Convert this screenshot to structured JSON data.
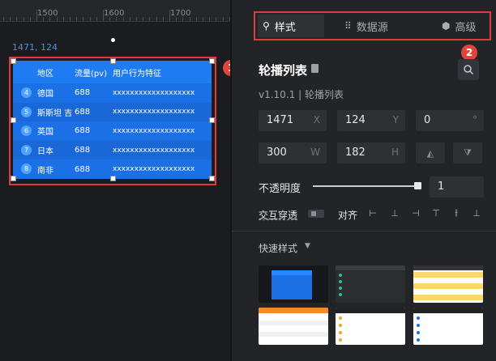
{
  "canvas": {
    "ruler_labels": [
      "1500",
      "1600",
      "1700"
    ],
    "coords": "1471, 124",
    "table": {
      "headers": [
        "地区",
        "流量(pv)",
        "用户行为特征"
      ],
      "rows": [
        {
          "idx": "4",
          "region": "德国",
          "pv": "688",
          "feature": "xxxxxxxxxxxxxxxxxxx"
        },
        {
          "idx": "5",
          "region": "斯斯坦 吉",
          "pv": "688",
          "feature": "xxxxxxxxxxxxxxxxxxx"
        },
        {
          "idx": "6",
          "region": "英国",
          "pv": "688",
          "feature": "xxxxxxxxxxxxxxxxxxx"
        },
        {
          "idx": "7",
          "region": "日本",
          "pv": "688",
          "feature": "xxxxxxxxxxxxxxxxxxx"
        },
        {
          "idx": "8",
          "region": "南非",
          "pv": "688",
          "feature": "xxxxxxxxxxxxxxxxxxx"
        }
      ]
    },
    "badge1": "1"
  },
  "panel": {
    "tabs": [
      {
        "label": "样式",
        "icon": "style-icon"
      },
      {
        "label": "数据源",
        "icon": "datasource-icon"
      },
      {
        "label": "高级",
        "icon": "advanced-icon"
      }
    ],
    "badge2": "2",
    "title": "轮播列表",
    "version": "v1.10.1 | 轮播列表",
    "x": "1471",
    "x_unit": "X",
    "y": "124",
    "y_unit": "Y",
    "rotate": "0",
    "rotate_unit": "°",
    "w": "300",
    "w_unit": "W",
    "h": "182",
    "h_unit": "H",
    "opacity_label": "不透明度",
    "opacity_value": "1",
    "opacity_level": 1,
    "interact_label": "交互穿透",
    "align_label": "对齐",
    "quick_style_label": "快速样式",
    "colors": {
      "accent": "#1b70e6",
      "highlight": "#e03c3c"
    }
  }
}
